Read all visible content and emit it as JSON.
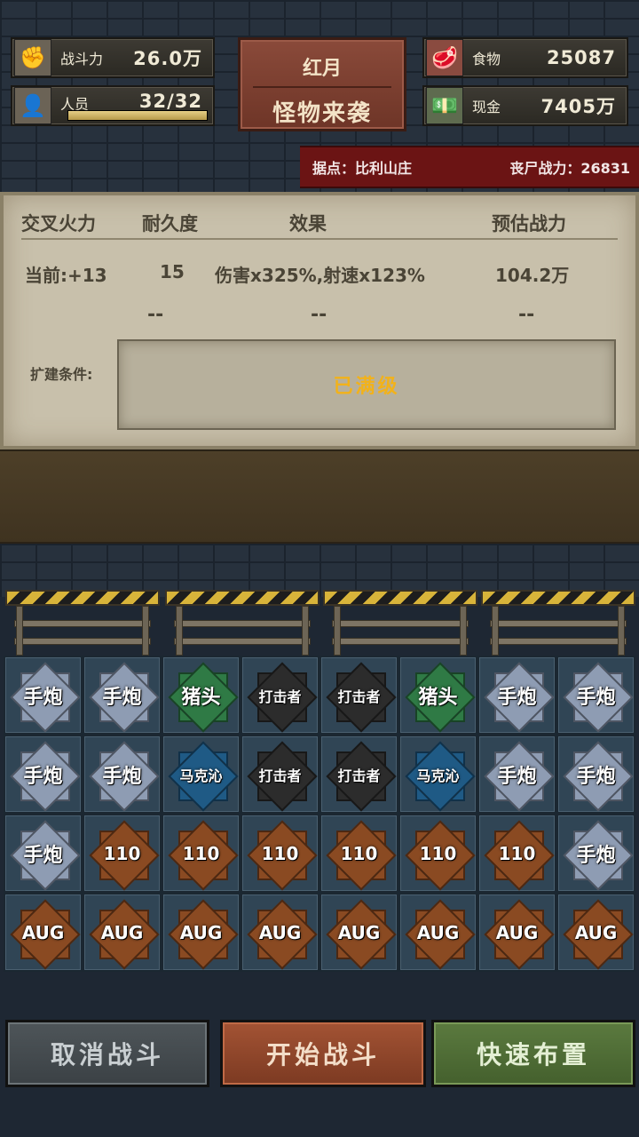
{
  "stats": {
    "combat_power": {
      "label": "战斗力",
      "value": "26.0万",
      "icon": "fist-icon"
    },
    "personnel": {
      "label": "人员",
      "value": "32/32",
      "icon": "person-icon",
      "progress": 1.0
    },
    "food": {
      "label": "食物",
      "value": "25087",
      "icon": "meat-icon"
    },
    "cash": {
      "label": "现金",
      "value": "7405万",
      "icon": "cash-icon"
    }
  },
  "event_sign": {
    "line1": "红月",
    "line2": "怪物来袭"
  },
  "base_banner": {
    "base": "据点：比利山庄",
    "zombie_power": "丧尸战力：26831"
  },
  "panel": {
    "headers": [
      "交叉火力",
      "耐久度",
      "效果",
      "预估战力"
    ],
    "current": {
      "level": "当前:+13",
      "durability": "15",
      "effect": "伤害x325%,射速x123%",
      "estimate": "104.2万"
    },
    "next": {
      "durability": "--",
      "effect": "--",
      "estimate": "--"
    },
    "condition_label": "扩建条件:",
    "condition_value": "已满级"
  },
  "grid": [
    [
      {
        "label": "手炮",
        "kind": "silver"
      },
      {
        "label": "手炮",
        "kind": "silver"
      },
      {
        "label": "猪头",
        "kind": "green"
      },
      {
        "label": "打击者",
        "kind": "black"
      },
      {
        "label": "打击者",
        "kind": "black"
      },
      {
        "label": "猪头",
        "kind": "green"
      },
      {
        "label": "手炮",
        "kind": "silver"
      },
      {
        "label": "手炮",
        "kind": "silver"
      }
    ],
    [
      {
        "label": "手炮",
        "kind": "silver"
      },
      {
        "label": "手炮",
        "kind": "silver"
      },
      {
        "label": "马克沁",
        "kind": "blue"
      },
      {
        "label": "打击者",
        "kind": "black"
      },
      {
        "label": "打击者",
        "kind": "black"
      },
      {
        "label": "马克沁",
        "kind": "blue"
      },
      {
        "label": "手炮",
        "kind": "silver"
      },
      {
        "label": "手炮",
        "kind": "silver"
      }
    ],
    [
      {
        "label": "手炮",
        "kind": "silver"
      },
      {
        "label": "110",
        "kind": "bronze"
      },
      {
        "label": "110",
        "kind": "bronze"
      },
      {
        "label": "110",
        "kind": "bronze"
      },
      {
        "label": "110",
        "kind": "bronze"
      },
      {
        "label": "110",
        "kind": "bronze"
      },
      {
        "label": "110",
        "kind": "bronze"
      },
      {
        "label": "手炮",
        "kind": "silver"
      }
    ],
    [
      {
        "label": "AUG",
        "kind": "bronze"
      },
      {
        "label": "AUG",
        "kind": "bronze"
      },
      {
        "label": "AUG",
        "kind": "bronze"
      },
      {
        "label": "AUG",
        "kind": "bronze"
      },
      {
        "label": "AUG",
        "kind": "bronze"
      },
      {
        "label": "AUG",
        "kind": "bronze"
      },
      {
        "label": "AUG",
        "kind": "bronze"
      },
      {
        "label": "AUG",
        "kind": "bronze"
      }
    ]
  ],
  "badge_colors": {
    "silver": "#8e9cb3",
    "green": "#2f7a45",
    "black": "#2c2c2c",
    "blue": "#1f5a85",
    "bronze": "#8a4a22"
  },
  "buttons": {
    "cancel": "取消战斗",
    "start": "开始战斗",
    "quick": "快速布置"
  }
}
